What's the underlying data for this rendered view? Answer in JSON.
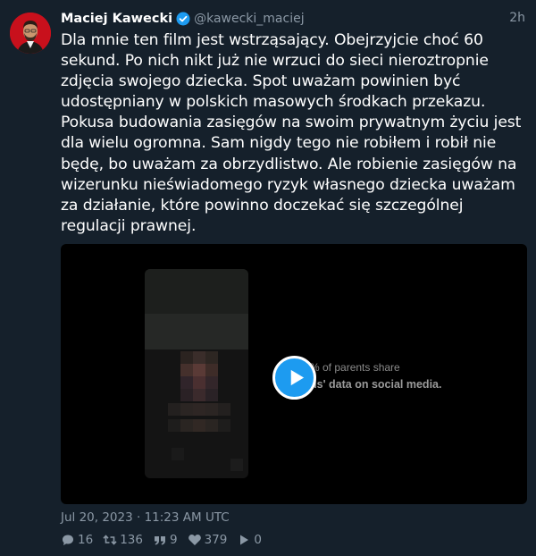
{
  "tweet": {
    "author_name": "Maciej Kawecki",
    "handle": "@kawecki_maciej",
    "time_ago": "2h",
    "text": "Dla mnie ten film jest wstrząsający. Obejrzyjcie choć 60 sekund. Po nich nikt już nie wrzuci do sieci nieroztropnie zdjęcia swojego dziecka. Spot uważam powinien być udostępniany w polskich masowych środkach przekazu. Pokusa budowania zasięgów na swoim prywatnym życiu jest dla wielu ogromna. Sam nigdy tego nie robiłem i robił nie będę, bo uważam za obrzydlistwo. Ale robienie zasięgów na wizerunku nieświadomego ryzyk własnego dziecka uważam za działanie, które powinno doczekać się szczególnej regulacji prawnej.",
    "date": "Jul 20, 2023 · 11:23 AM UTC"
  },
  "media": {
    "overlay_line1": "% of parents share",
    "overlay_line2": "ds' data on social media."
  },
  "stats": {
    "replies": "16",
    "retweets": "136",
    "quotes": "9",
    "likes": "379",
    "views": "0"
  },
  "colors": {
    "background": "#15202b",
    "accent": "#1d9bf0",
    "muted": "#8b98a5"
  },
  "icons": [
    "verified-badge-icon",
    "play-icon",
    "reply-icon",
    "retweet-icon",
    "quote-icon",
    "like-icon",
    "views-icon"
  ]
}
